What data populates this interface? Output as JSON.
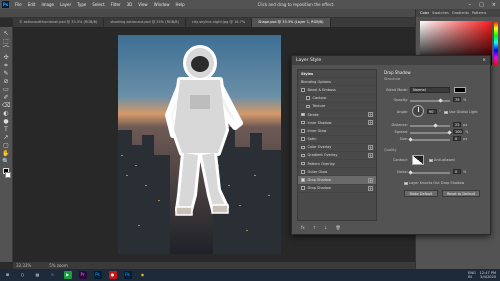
{
  "menubar": {
    "logo": "Ps",
    "items": [
      "File",
      "Edit",
      "Image",
      "Layer",
      "Type",
      "Select",
      "Filter",
      "3D",
      "View",
      "Window",
      "Help"
    ],
    "hint": "Click and drag to reposition the effect.",
    "controls": [
      "–",
      "□",
      "×"
    ]
  },
  "tabs": [
    "© astronautthumbnail.psd @ 33.3% (RGB/8)",
    "shooting astronaut.psd @ 25% (RGB/8)",
    "city-skyline-night.jpg @ 16.7%",
    "Shape.psd @ 33.3% (Layer 1, RGB/8)"
  ],
  "active_tab_index": 3,
  "tools": [
    "↖",
    "⬚",
    "⌒",
    "✣",
    "⌗",
    "✎",
    "⊘",
    "▭",
    "✐",
    "⌫",
    "◐",
    "●",
    "T",
    "↗",
    "▢",
    "✋",
    "🔍"
  ],
  "status": {
    "zoom": "33.33%",
    "doc": "5% zoom"
  },
  "right_panel": {
    "tabs": [
      "Color",
      "Swatches",
      "Gradients",
      "Patterns"
    ],
    "active_tab": "Color"
  },
  "dialog": {
    "title": "Layer Style",
    "close": "×",
    "styles_header": "Styles",
    "styles": [
      {
        "label": "Blending Options",
        "check": false,
        "indent": false,
        "plus": false,
        "sel": false
      },
      {
        "label": "Bevel & Emboss",
        "check": true,
        "on": false,
        "indent": false,
        "plus": false,
        "sel": false
      },
      {
        "label": "Contour",
        "check": true,
        "on": false,
        "indent": true,
        "plus": false,
        "sel": false
      },
      {
        "label": "Texture",
        "check": true,
        "on": false,
        "indent": true,
        "plus": false,
        "sel": false
      },
      {
        "label": "Stroke",
        "check": true,
        "on": true,
        "indent": false,
        "plus": true,
        "sel": false
      },
      {
        "label": "Inner Shadow",
        "check": true,
        "on": false,
        "indent": false,
        "plus": true,
        "sel": false
      },
      {
        "label": "Inner Glow",
        "check": true,
        "on": false,
        "indent": false,
        "plus": false,
        "sel": false
      },
      {
        "label": "Satin",
        "check": true,
        "on": false,
        "indent": false,
        "plus": false,
        "sel": false
      },
      {
        "label": "Color Overlay",
        "check": true,
        "on": false,
        "indent": false,
        "plus": true,
        "sel": false
      },
      {
        "label": "Gradient Overlay",
        "check": true,
        "on": false,
        "indent": false,
        "plus": true,
        "sel": false
      },
      {
        "label": "Pattern Overlay",
        "check": true,
        "on": false,
        "indent": false,
        "plus": false,
        "sel": false
      },
      {
        "label": "Outer Glow",
        "check": true,
        "on": false,
        "indent": false,
        "plus": false,
        "sel": false
      },
      {
        "label": "Drop Shadow",
        "check": true,
        "on": true,
        "indent": false,
        "plus": true,
        "sel": true
      },
      {
        "label": "Drop Shadow",
        "check": true,
        "on": false,
        "indent": false,
        "plus": true,
        "sel": false
      }
    ],
    "footer": {
      "fx": "fx",
      "up": "↑",
      "down": "↓",
      "trash": "🗑"
    },
    "settings": {
      "section": "Drop Shadow",
      "structure": "Structure",
      "blend_mode_label": "Blend Mode:",
      "blend_mode": "Normal",
      "opacity_label": "Opacity:",
      "opacity": "75",
      "opacity_unit": "%",
      "angle_label": "Angle:",
      "angle": "90",
      "angle_unit": "°",
      "global_light": "Use Global Light",
      "distance_label": "Distance:",
      "distance": "22",
      "distance_unit": "px",
      "spread_label": "Spread:",
      "spread": "100",
      "spread_unit": "%",
      "size_label": "Size:",
      "size": "0",
      "size_unit": "px",
      "quality": "Quality",
      "contour_label": "Contour:",
      "anti_aliased": "Anti-aliased",
      "noise_label": "Noise:",
      "noise": "0",
      "noise_unit": "%",
      "knockout": "Layer Knocks Out Drop Shadow",
      "make_default": "Make Default",
      "reset_default": "Reset to Default"
    }
  },
  "taskbar": {
    "apps": [
      "⊞",
      "○",
      "▤",
      "e",
      "▶",
      "Pr",
      "Ps",
      "●",
      "Ps",
      "◉"
    ],
    "lang": "ENG\nIN",
    "time": "12:47 PM",
    "date": "5/4/2020"
  }
}
